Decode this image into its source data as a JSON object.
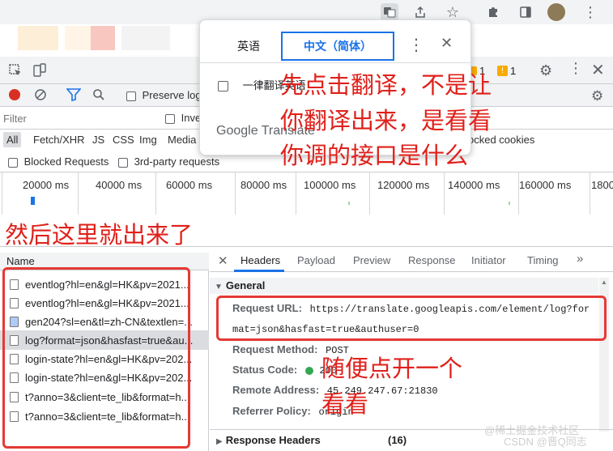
{
  "popup": {
    "tab_english": "英语",
    "tab_chinese": "中文（简体）",
    "always_translate": "一律翻译英语",
    "google_translate": "Google Translate"
  },
  "devtools": {
    "badges": [
      "1",
      "1"
    ],
    "preserve_log": "Preserve log",
    "filter_placeholder": "Filter",
    "invert": "Inve",
    "types": [
      "All",
      "Fetch/XHR",
      "JS",
      "CSS",
      "Img",
      "Media"
    ],
    "blocked_cookies": "ocked cookies",
    "blocked_requests": "Blocked Requests",
    "third_party": "3rd-party requests",
    "timeline_ticks": [
      "20000 ms",
      "40000 ms",
      "60000 ms",
      "80000 ms",
      "100000 ms",
      "120000 ms",
      "140000 ms",
      "160000 ms",
      "1800"
    ],
    "name_header": "Name",
    "requests": [
      "eventlog?hl=en&gl=HK&pv=2021...",
      "eventlog?hl=en&gl=HK&pv=2021...",
      "gen204?sl=en&tl=zh-CN&textlen=...",
      "log?format=json&hasfast=true&au...",
      "login-state?hl=en&gl=HK&pv=202...",
      "login-state?hl=en&gl=HK&pv=202...",
      "t?anno=3&client=te_lib&format=h...",
      "t?anno=3&client=te_lib&format=h..."
    ],
    "detail_tabs": [
      "Headers",
      "Payload",
      "Preview",
      "Response",
      "Initiator",
      "Timing",
      "»"
    ],
    "general_label": "General",
    "request_url_key": "Request URL:",
    "request_url_line1": "https://translate.googleapis.com/element/log?for",
    "request_url_line2": "mat=json&hasfast=true&authuser=0",
    "request_method_key": "Request Method:",
    "request_method_val": "POST",
    "status_code_key": "Status Code:",
    "status_code_val": "200",
    "remote_address_key": "Remote Address:",
    "remote_address_val": "45.249.247.67:21830",
    "referrer_policy_key": "Referrer Policy:",
    "referrer_policy_val": "origin",
    "response_headers": "Response Headers",
    "response_headers_count": "(16)"
  },
  "annotations": {
    "note_top_1": "先点击翻译，不是让",
    "note_top_2": "你翻译出来，是看看",
    "note_top_3": "你调的接口是什么",
    "note_left": "然后这里就出来了",
    "note_bottom_1": "随便点开一个",
    "note_bottom_2": "看看"
  },
  "watermark": {
    "line1": "@稀土掘金技术社区",
    "line2": "CSDN @晋Q同志"
  },
  "colors": {
    "annotation_red": "#e53935",
    "accent_blue": "#1a73e8",
    "record_red": "#d93025",
    "status_green": "#34a853"
  }
}
